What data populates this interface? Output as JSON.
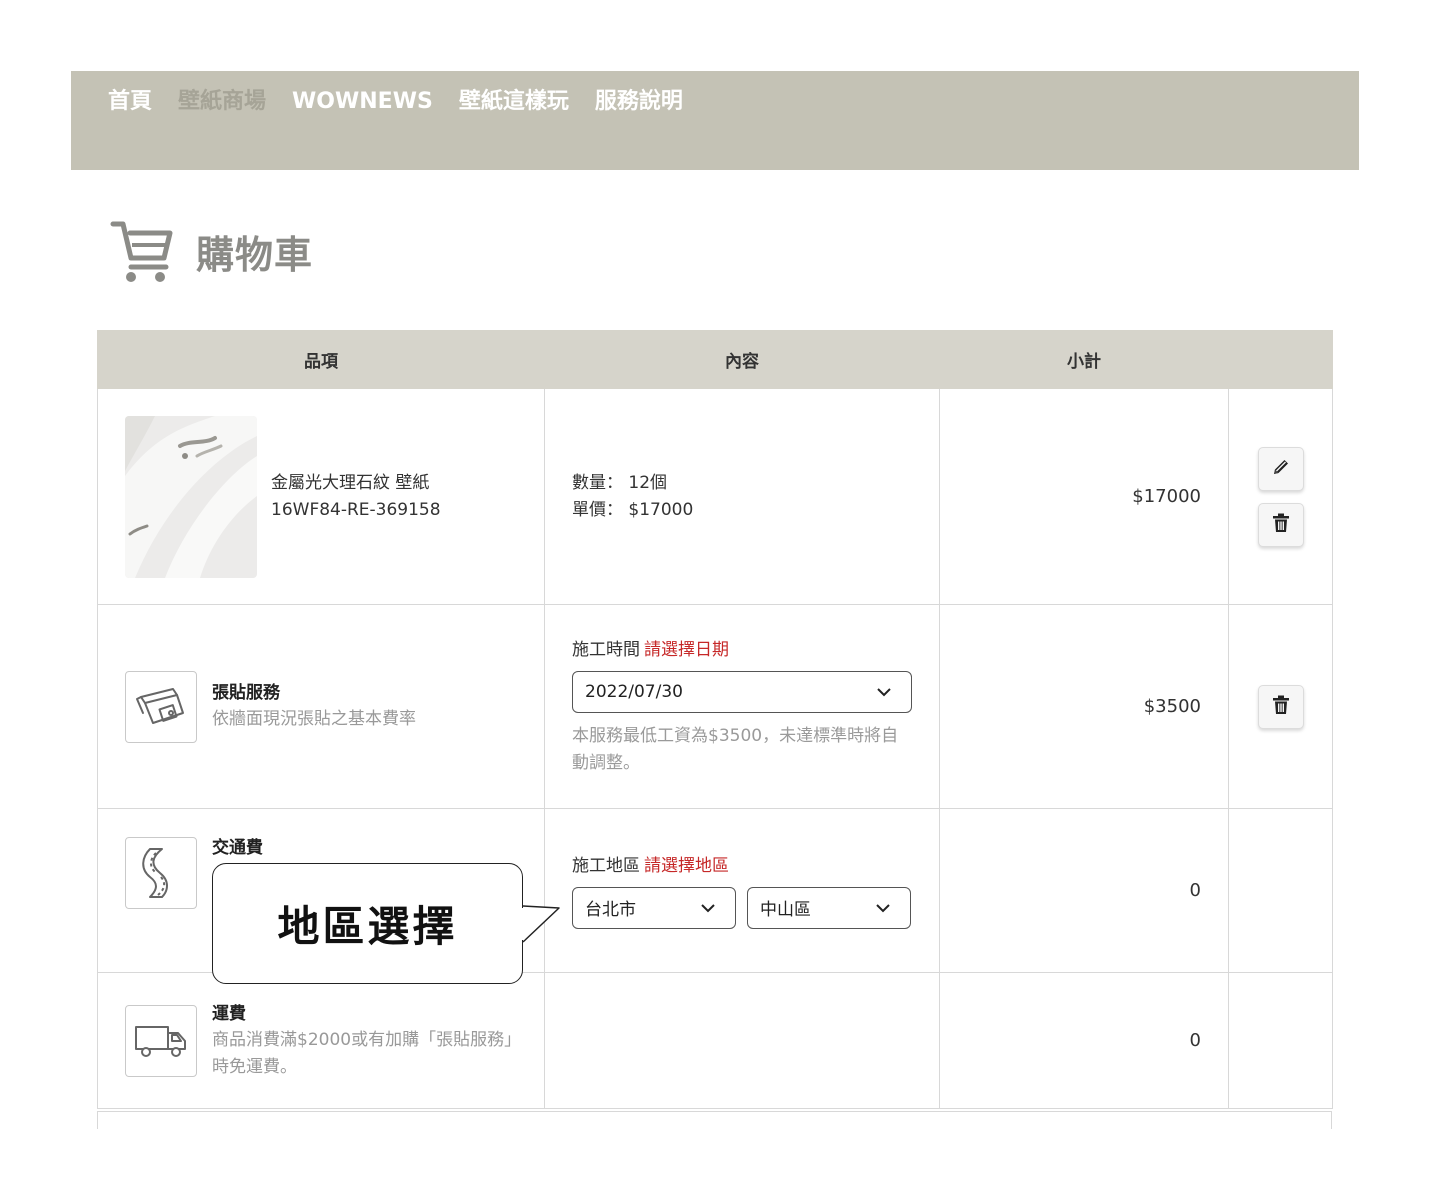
{
  "nav": {
    "items": [
      "首頁",
      "壁紙商場",
      "WOWNEWS",
      "壁紙這樣玩",
      "服務說明"
    ],
    "active_index": 1
  },
  "page": {
    "title": "購物車",
    "icon": "cart-icon"
  },
  "table": {
    "headers": [
      "品項",
      "內容",
      "小計"
    ],
    "product": {
      "name": "金屬光大理石紋 壁紙",
      "code": "16WF84-RE-369158",
      "qty_label": "數量：",
      "qty": "12個",
      "price_label": "單價：",
      "price": "$17000",
      "subtotal": "$17000"
    },
    "install": {
      "icon": "wallpaper-roll-icon",
      "name": "張貼服務",
      "desc": "依牆面現況張貼之基本費率",
      "field_label": "施工時間",
      "field_req": "請選擇日期",
      "date_value": "2022/07/30",
      "note": "本服務最低工資為$3500，未達標準時將自動調整。",
      "subtotal": "$3500"
    },
    "transport": {
      "icon": "road-icon",
      "name": "交通費",
      "field_label": "施工地區",
      "field_req": "請選擇地區",
      "city": "台北市",
      "district": "中山區",
      "subtotal": "0"
    },
    "shipping": {
      "icon": "truck-icon",
      "name": "運費",
      "desc": "商品消費滿$2000或有加購「張貼服務」時免運費。",
      "subtotal": "0"
    }
  },
  "callout": {
    "text": "地區選擇"
  },
  "colors": {
    "nav_bg": "#c4c2b5",
    "header_bg": "#d6d4cb",
    "required": "#c62828"
  }
}
